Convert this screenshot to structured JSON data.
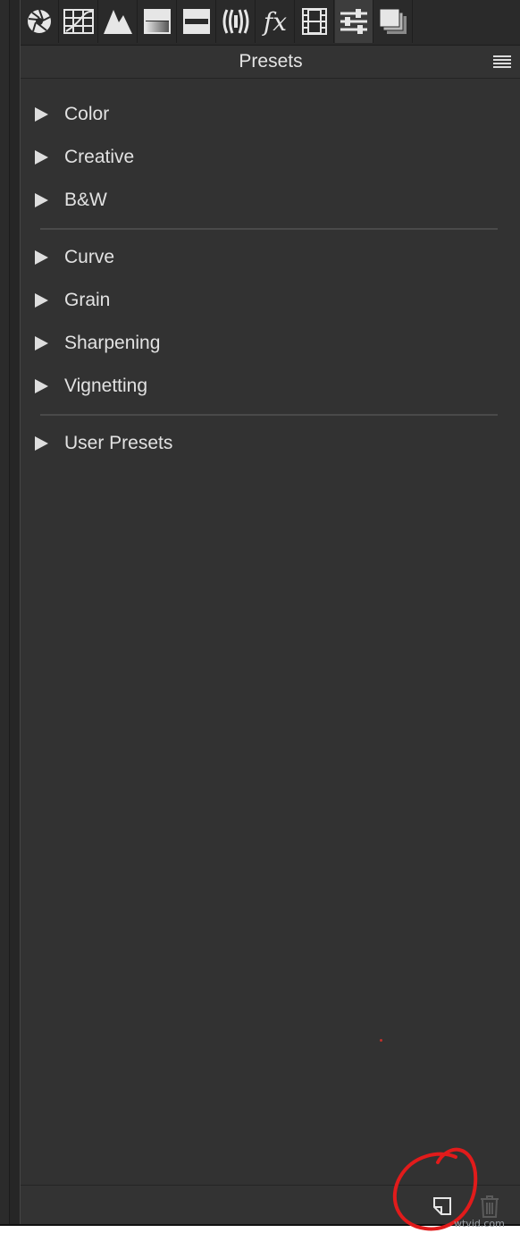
{
  "toolbar": {
    "tools": [
      {
        "icon": "aperture-icon"
      },
      {
        "icon": "grid-icon"
      },
      {
        "icon": "peaks-icon"
      },
      {
        "icon": "gradient-filter-icon"
      },
      {
        "icon": "split-tone-icon"
      },
      {
        "icon": "lens-icon"
      },
      {
        "icon": "fx-icon",
        "label": "fx"
      },
      {
        "icon": "film-strip-icon"
      },
      {
        "icon": "sliders-icon",
        "active": true
      },
      {
        "icon": "layers-icon"
      }
    ]
  },
  "header": {
    "title": "Presets",
    "menu_icon": "hamburger-menu-icon"
  },
  "preset_groups": [
    {
      "label": "Color"
    },
    {
      "label": "Creative"
    },
    {
      "label": "B&W"
    },
    {
      "label": "Curve"
    },
    {
      "label": "Grain"
    },
    {
      "label": "Sharpening"
    },
    {
      "label": "Vignetting"
    },
    {
      "label": "User Presets"
    }
  ],
  "footer": {
    "new_icon": "new-preset-icon",
    "delete_icon": "trash-icon"
  },
  "colors": {
    "panel_bg": "#323232",
    "toolbar_bg": "#2a2a2a",
    "text": "#e2e2e2",
    "annotation": "#e11b1b"
  },
  "watermark": "wtvid.com"
}
